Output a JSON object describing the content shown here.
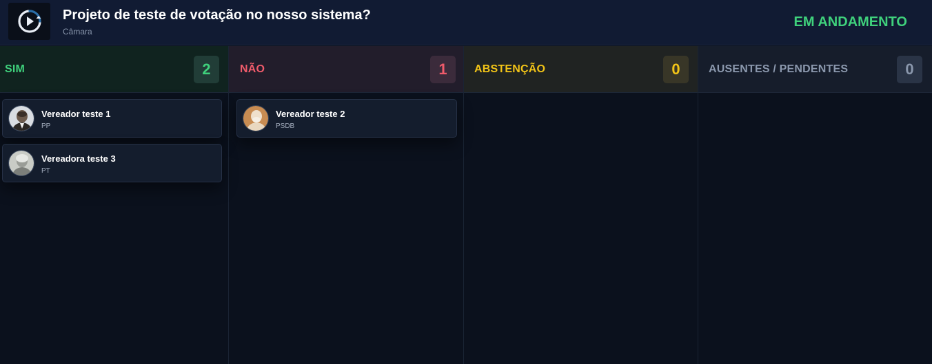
{
  "header": {
    "logo_icon": "play-clock-icon",
    "title": "Projeto de teste de votação no nosso sistema?",
    "subtitle": "Câmara",
    "status": "EM ANDAMENTO",
    "status_color": "#3fd17c"
  },
  "columns": [
    {
      "title": "SIM",
      "count": "2",
      "color": "#3fd17c",
      "voters": [
        {
          "name": "Vereador teste 1",
          "party": "PP"
        },
        {
          "name": "Vereadora teste 3",
          "party": "PT"
        }
      ]
    },
    {
      "title": "NÃO",
      "count": "1",
      "color": "#ef5b6b",
      "voters": [
        {
          "name": "Vereador teste 2",
          "party": "PSDB"
        }
      ]
    },
    {
      "title": "ABSTENÇÃO",
      "count": "0",
      "color": "#f2c417",
      "voters": []
    },
    {
      "title": "AUSENTES / PENDENTES",
      "count": "0",
      "color": "#8b98ad",
      "voters": []
    }
  ]
}
